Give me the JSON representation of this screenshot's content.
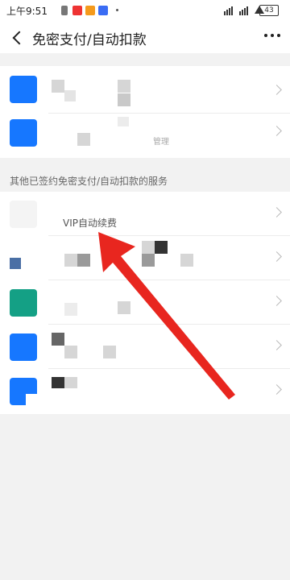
{
  "status_bar": {
    "time": "上午9:51",
    "network": "4G",
    "battery": "43"
  },
  "header": {
    "title": "免密支付/自动扣款"
  },
  "section": {
    "label": "其他已签约免密支付/自动扣款的服务"
  },
  "services": [
    {
      "name": "VIP自动续费"
    }
  ],
  "partial_texts": {
    "row2_sub": "管理"
  },
  "colors": {
    "accent_blue": "#1677ff",
    "teal": "#14a085",
    "arrow_red": "#e8261f"
  }
}
